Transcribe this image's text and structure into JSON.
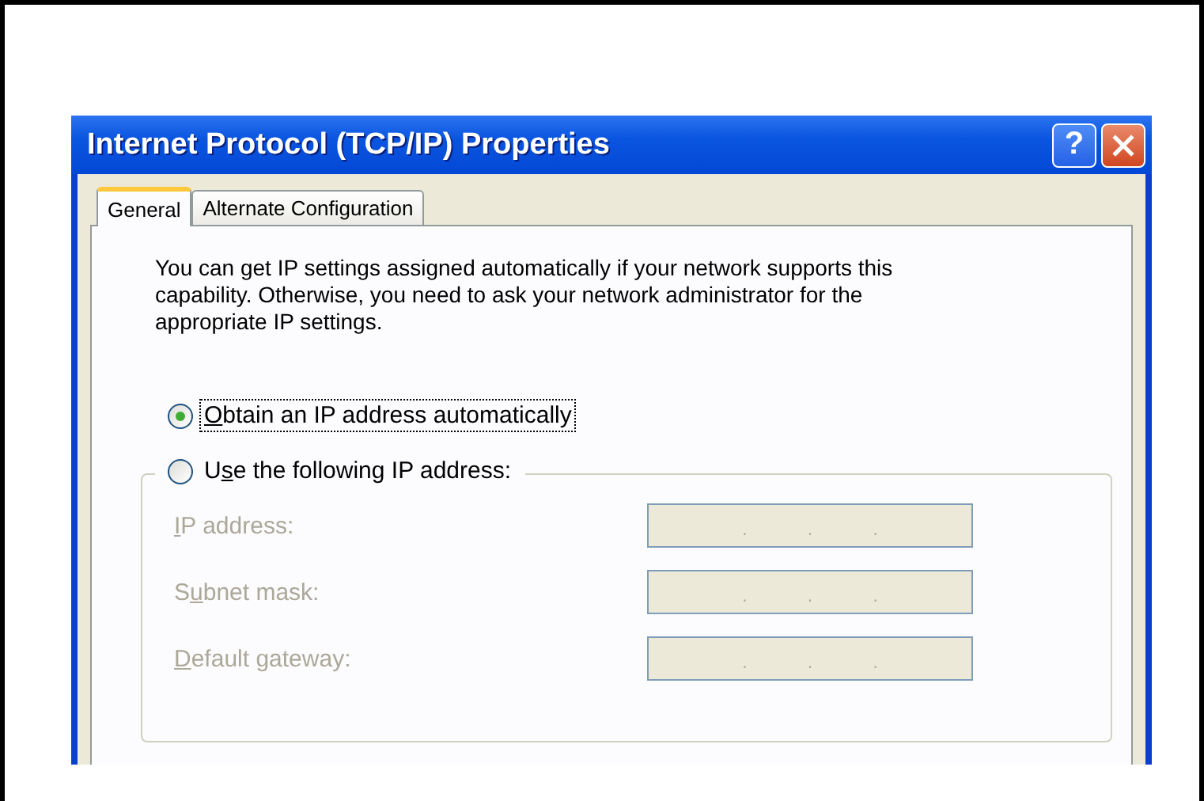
{
  "window": {
    "title": "Internet Protocol (TCP/IP) Properties",
    "help_glyph": "?"
  },
  "tabs": [
    {
      "label": "General",
      "selected": true
    },
    {
      "label": "Alternate Configuration",
      "selected": false
    }
  ],
  "intro": "You can get IP settings assigned automatically if your network supports this capability. Otherwise, you need to ask your network administrator for the appropriate IP settings.",
  "options": [
    {
      "key": "O",
      "post": "btain an IP address automatically",
      "selected": true,
      "focused": true
    },
    {
      "pre": "U",
      "key": "s",
      "post": "e the following IP address:",
      "selected": false,
      "focused": false
    }
  ],
  "fields": [
    {
      "key": "I",
      "post": "P address:",
      "disabled": true,
      "dots": [
        ".",
        ".",
        "."
      ]
    },
    {
      "pre": "S",
      "key": "u",
      "post": "bnet mask:",
      "disabled": true,
      "dots": [
        ".",
        ".",
        "."
      ]
    },
    {
      "key": "D",
      "post": "efault gateway:",
      "disabled": true,
      "dots": [
        ".",
        ".",
        "."
      ]
    }
  ]
}
